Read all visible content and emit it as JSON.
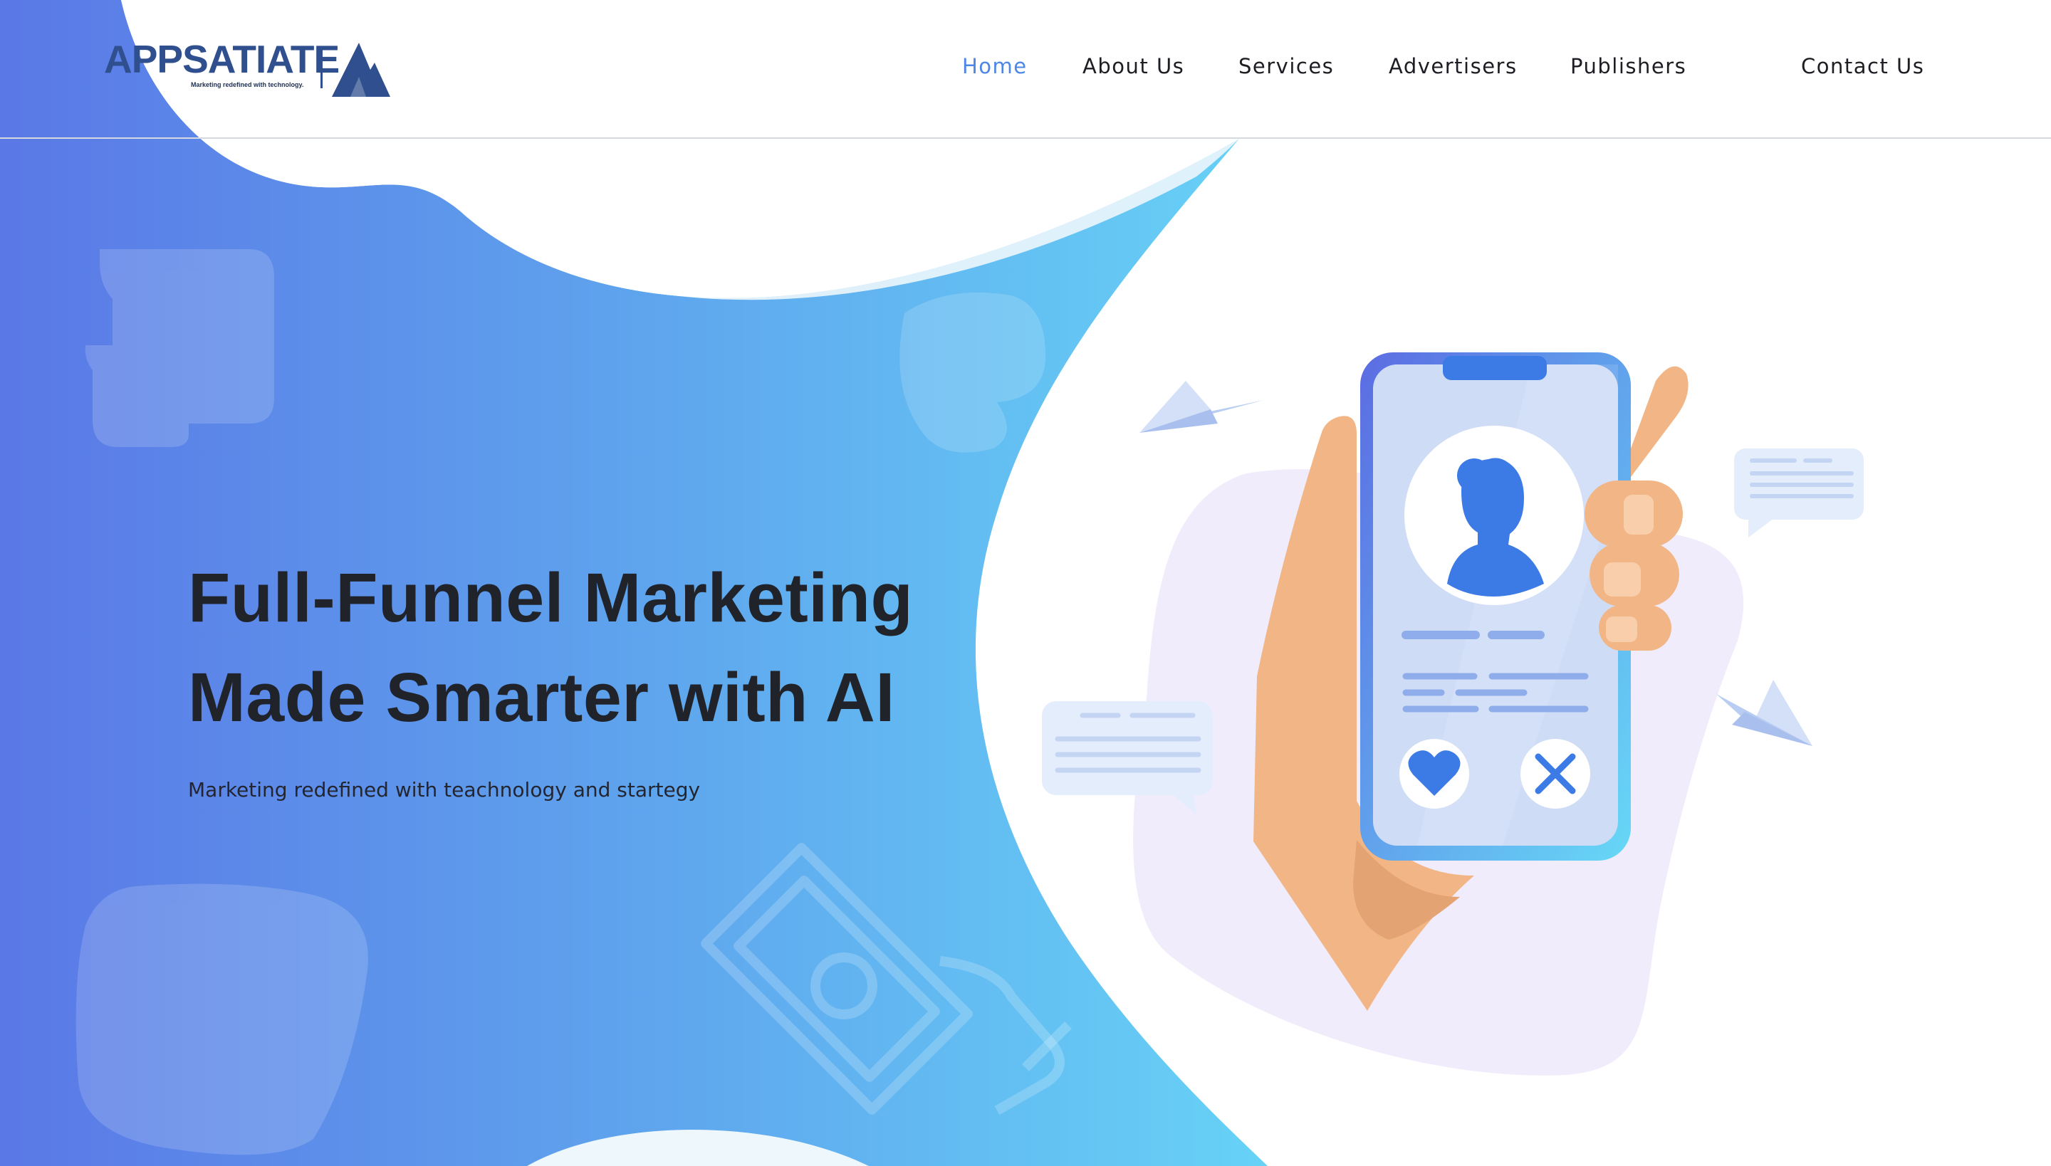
{
  "brand": {
    "name": "APPSATIATE",
    "tagline": "Marketing redefined with technology."
  },
  "nav": {
    "items": [
      {
        "label": "Home",
        "active": true
      },
      {
        "label": "About Us",
        "active": false
      },
      {
        "label": "Services",
        "active": false
      },
      {
        "label": "Advertisers",
        "active": false
      },
      {
        "label": "Publishers",
        "active": false
      }
    ],
    "contact_label": "Contact Us"
  },
  "hero": {
    "title_line1": "Full-Funnel Marketing",
    "title_line2": "Made Smarter with AI",
    "subtitle": "Marketing redefined with teachnology and startegy"
  },
  "colors": {
    "brand_navy": "#2f4f8f",
    "nav_active": "#4d86e6",
    "gradient_start": "#5a78e6",
    "gradient_end": "#67d2f6",
    "heading": "#21232b",
    "phone_blue": "#3c7ae6",
    "hand_skin": "#f2b585",
    "blob_lavender": "#f0ecfb"
  },
  "illustration": {
    "icons": [
      "paper-plane-icon",
      "chat-bubble-icon",
      "user-avatar-icon",
      "heart-icon",
      "close-icon",
      "money-hand-icon"
    ]
  }
}
